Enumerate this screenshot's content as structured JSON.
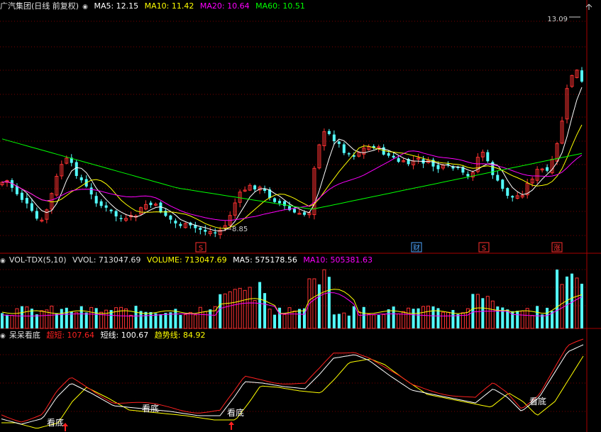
{
  "main_panel": {
    "title": "广汽集团(日线 前复权)",
    "ma_labels": [
      {
        "text": "MA5: 12.15",
        "color": "#ffffff"
      },
      {
        "text": "MA10: 11.42",
        "color": "#ffff00"
      },
      {
        "text": "MA20: 10.64",
        "color": "#ff00ff"
      },
      {
        "text": "MA60: 10.51",
        "color": "#00ff00"
      }
    ],
    "high_label": "13.09",
    "low_label": "8.85",
    "markers": [
      {
        "text": "S",
        "color": "#ff3030"
      },
      {
        "text": "财",
        "color": "#4da6ff"
      },
      {
        "text": "S",
        "color": "#ff3030"
      },
      {
        "text": "涨",
        "color": "#ff3030"
      }
    ]
  },
  "volume_panel": {
    "title": "VOL-TDX(5,10)",
    "labels": [
      {
        "text": "VVOL: 713047.69",
        "color": "#e0e0e0"
      },
      {
        "text": "VOLUME: 713047.69",
        "color": "#ffff00"
      },
      {
        "text": "MA5: 575178.56",
        "color": "#ffffff"
      },
      {
        "text": "MA10: 505381.63",
        "color": "#ff00ff"
      }
    ]
  },
  "indicator_panel": {
    "title": "呆呆看底",
    "labels": [
      {
        "text": "超短: 107.64",
        "color": "#ff2020"
      },
      {
        "text": "短线: 100.67",
        "color": "#ffffff"
      },
      {
        "text": "趋势线: 84.92",
        "color": "#ffff00"
      }
    ],
    "signals": [
      "看底",
      "看底",
      "看底",
      "看底"
    ]
  },
  "colors": {
    "up": "#ff3232",
    "down": "#54ffff",
    "grid": "#7a0000",
    "separator": "#aa0000"
  },
  "icons": [
    "corner-up-arrow-icon",
    "up-arrow-icon"
  ]
}
